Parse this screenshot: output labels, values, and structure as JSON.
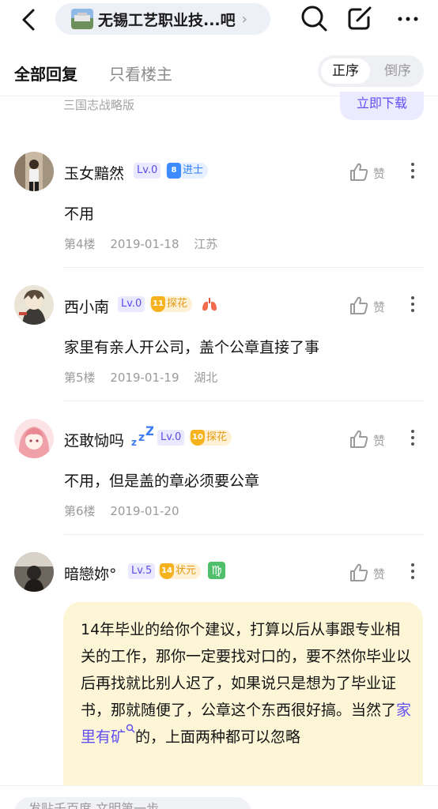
{
  "header": {
    "forum_name": "无锡工艺职业技...吧",
    "chevron": "›"
  },
  "filter": {
    "all_replies": "全部回复",
    "owner_only": "只看楼主",
    "order_asc": "正序",
    "order_desc": "倒序"
  },
  "ad": {
    "text": "三国志战略版",
    "button": "立即下载"
  },
  "posts": [
    {
      "username": "玉女黯然",
      "level": "Lv.0",
      "rank_number": "8",
      "rank_title": "进士",
      "like_label": "赞",
      "content": "不用",
      "floor": "第4楼",
      "date": "2019-01-18",
      "location": "江苏"
    },
    {
      "username": "西小南",
      "level": "Lv.0",
      "rank_number": "11",
      "rank_title": "探花",
      "like_label": "赞",
      "content": "家里有亲人开公司，盖个公章直接了事",
      "floor": "第5楼",
      "date": "2019-01-19",
      "location": "湖北"
    },
    {
      "username": "还敢恸吗",
      "level": "Lv.0",
      "rank_number": "10",
      "rank_title": "探花",
      "like_label": "赞",
      "content": "不用，但是盖的章必须要公章",
      "floor": "第6楼",
      "date": "2019-01-20"
    },
    {
      "username": "暗戀妳°",
      "level": "Lv.5",
      "rank_number": "14",
      "rank_title": "状元",
      "zodiac": "♍",
      "like_label": "赞",
      "content_parts": {
        "before_link": "14年毕业的给你个建议，打算以后从事跟专业相关的工作，那你一定要找对口的，要不然你毕业以后再找就比别人迟了，如果说只是想为了毕业证书，那就随便了，公章这个东西很好搞。当然了",
        "link": "家里有矿",
        "after_link": "的，上面两种都可以忽略"
      }
    }
  ],
  "bottom": {
    "reply_placeholder": "发贴千百度 文明第一步"
  },
  "colors": {
    "accent": "#614ff4",
    "level_badge_bg": "#ebe9ff",
    "quote_bg": "#fdf6d6",
    "jinshi_badge": "#3d8bff",
    "tanhua_badge": "#f5b21c"
  }
}
